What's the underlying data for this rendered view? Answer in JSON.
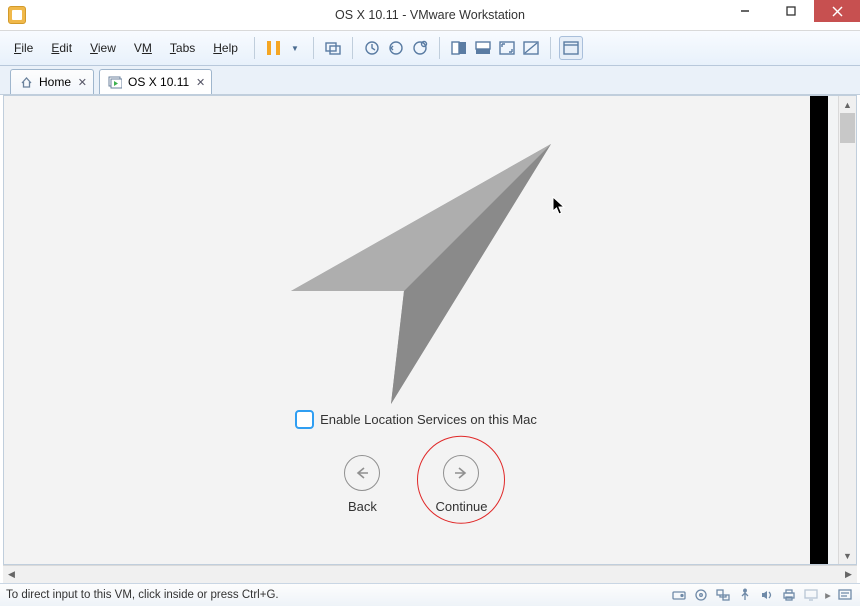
{
  "window": {
    "title": "OS X 10.11 - VMware Workstation"
  },
  "menu": {
    "file": "File",
    "edit": "Edit",
    "view": "View",
    "vm": "VM",
    "tabs": "Tabs",
    "help": "Help"
  },
  "tabs": {
    "home": "Home",
    "osx": "OS X 10.11"
  },
  "osx_setup": {
    "checkbox_label": "Enable Location Services on this Mac",
    "back": "Back",
    "continue": "Continue"
  },
  "status": {
    "hint": "To direct input to this VM, click inside or press Ctrl+G."
  },
  "colors": {
    "accent": "#2f9ef2",
    "highlight": "#e02828",
    "toolbar_icon": "#5a7ca3"
  }
}
